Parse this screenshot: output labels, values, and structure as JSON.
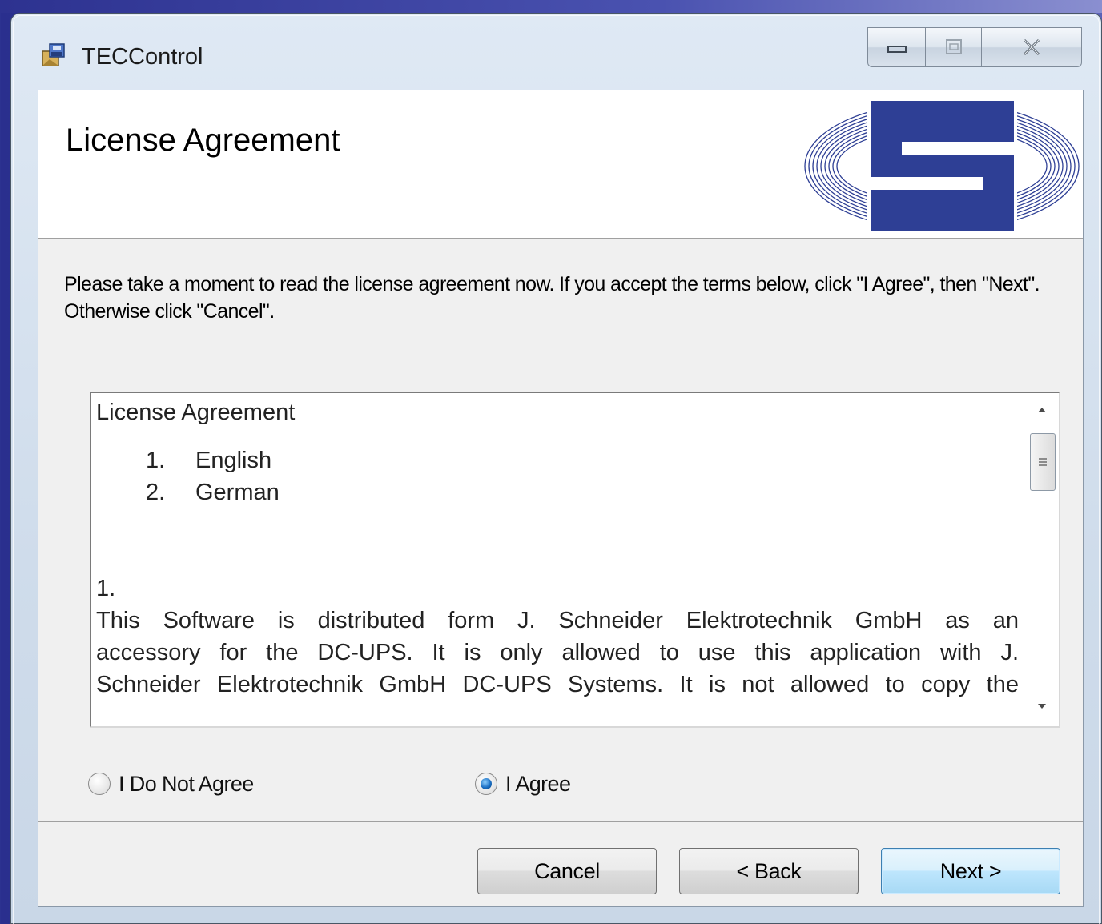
{
  "window": {
    "title": "TECControl",
    "icon": "installer-icon",
    "caption_icons": [
      "minimize-icon",
      "maximize-icon",
      "close-icon"
    ]
  },
  "banner": {
    "title": "License Agreement",
    "logo": "company-logo"
  },
  "instructions": "Please take a moment to read the license agreement now. If you accept the terms below, click \"I Agree\", then \"Next\". Otherwise click \"Cancel\".",
  "license": {
    "heading": "License Agreement",
    "list": [
      {
        "num": "1.",
        "label": "English"
      },
      {
        "num": "2.",
        "label": "German"
      }
    ],
    "section_number": "1.",
    "paragraph_lines": [
      "This Software is distributed form J. Schneider Elektrotechnik GmbH as an",
      "accessory for the DC-UPS. It is only allowed to use this application with J.",
      "Schneider Elektrotechnik GmbH DC-UPS Systems. It is not allowed to copy the"
    ]
  },
  "radios": {
    "disagree_label": "I Do Not Agree",
    "agree_label": "I Agree",
    "selected": "agree"
  },
  "buttons": {
    "cancel": "Cancel",
    "back": "< Back",
    "next": "Next >"
  },
  "colors": {
    "logo_blue": "#2e3f95",
    "desktop_blue": "#3a43a6",
    "radio_selected": "#1a6fc4"
  }
}
